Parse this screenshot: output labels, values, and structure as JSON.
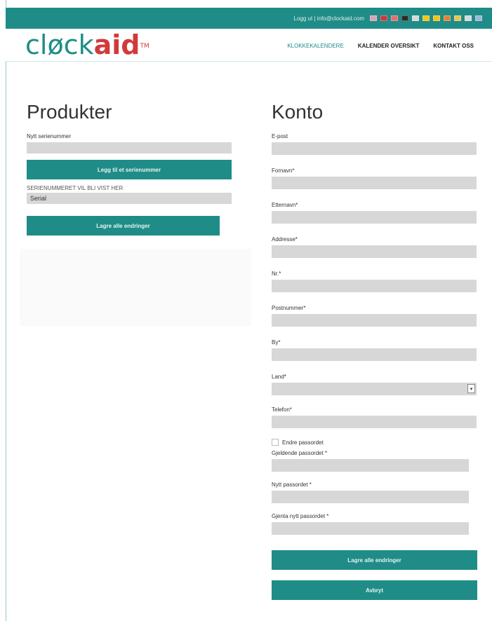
{
  "topbar": {
    "links": "Logg ut | info@clockaid.com",
    "flags": [
      "#d9a3b5",
      "#c43b3b",
      "#e36f6f",
      "#2b2b2b",
      "#d8d8d8",
      "#f0c419",
      "#f0c419",
      "#e0823a",
      "#e9c35b",
      "#d9d9d9",
      "#9fb7d6"
    ]
  },
  "header": {
    "logo_part1": "cløck",
    "logo_part2": "aid",
    "logo_tm": "TM",
    "nav": [
      "KLOKKEKALENDERE",
      "KALENDER OVERSIKT",
      "KONTAKT OSS"
    ]
  },
  "produkter": {
    "title": "Produkter",
    "new_serial_label": "Nytt serienummer",
    "new_serial_value": "",
    "add_serial_button": "Legg til et serienummer",
    "serial_display_label": "SERIENUMMERET VIL BLI VIST HER",
    "serial_value": "Serial",
    "save_button": "Lagre alle endringer"
  },
  "konto": {
    "title": "Konto",
    "fields": [
      {
        "label": "E-post",
        "value": ""
      },
      {
        "label": "Fornavn*",
        "value": ""
      },
      {
        "label": "Etternavn*",
        "value": ""
      },
      {
        "label": "Addresse*",
        "value": ""
      },
      {
        "label": "Nr.*",
        "value": ""
      },
      {
        "label": "Postnummer*",
        "value": ""
      },
      {
        "label": "By*",
        "value": ""
      }
    ],
    "country_label": "Land*",
    "country_value": "",
    "phone_label": "Telefon*",
    "phone_value": "",
    "change_password_label": "Endre passordet",
    "current_password_label": "Gjeldende passordet *",
    "new_password_label": "Nytt passordet *",
    "repeat_password_label": "Gjenta nytt passordet *",
    "save_button": "Lagre alle endringer",
    "cancel_button": "Avbryt"
  }
}
